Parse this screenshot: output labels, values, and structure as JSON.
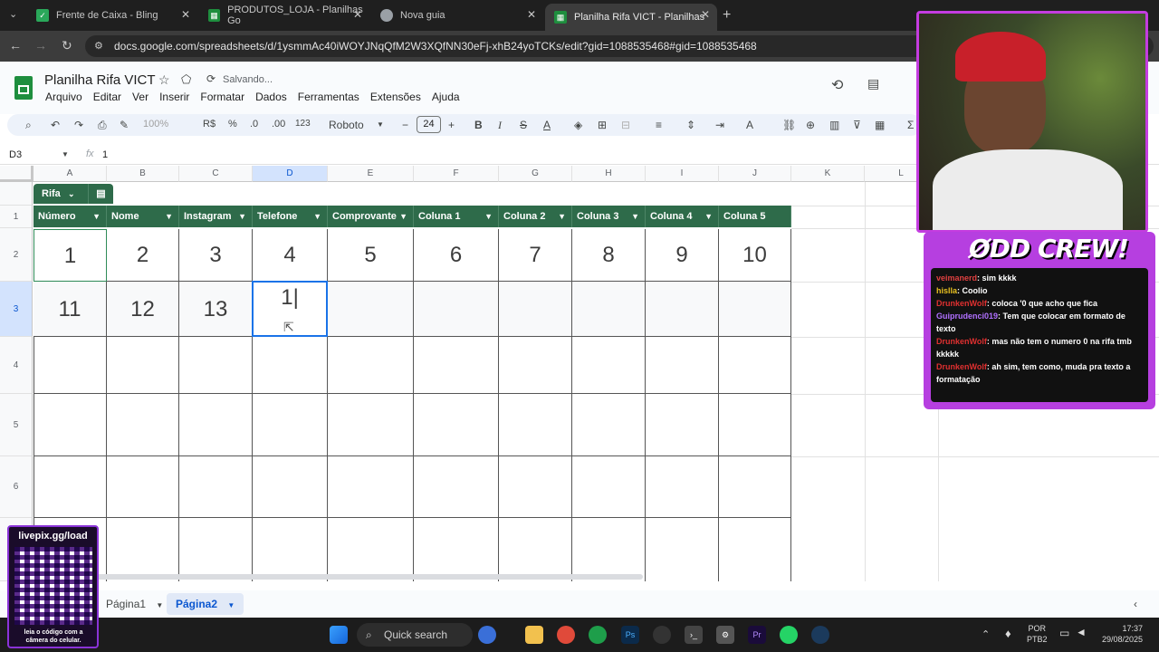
{
  "browser": {
    "tabs": [
      {
        "title": "Frente de Caixa - Bling",
        "icon": "bling-icon",
        "color": "#2aa85a"
      },
      {
        "title": "PRODUTOS_LOJA - Planilhas Go",
        "icon": "sheets-icon",
        "color": "#1e8e3e"
      },
      {
        "title": "Nova guia",
        "icon": "chrome-icon",
        "color": "#9aa0a6"
      },
      {
        "title": "Planilha Rifa VICT - Planilhas Go",
        "icon": "sheets-icon",
        "color": "#1e8e3e"
      }
    ],
    "url": "docs.google.com/spreadsheets/d/1ysmmAc40iWOYJNqQfM2W3XQfNN30eFj-xhB24yoTCKs/edit?gid=1088535468#gid=1088535468"
  },
  "sheets": {
    "title": "Planilha Rifa VICT",
    "status": "Salvando...",
    "menu": [
      "Arquivo",
      "Editar",
      "Ver",
      "Inserir",
      "Formatar",
      "Dados",
      "Ferramentas",
      "Extensões",
      "Ajuda"
    ],
    "toolbar": {
      "zoom": "100%",
      "currency": "R$",
      "percent": "%",
      "dec_less": ".0",
      "dec_more": ".00",
      "number_format": "123",
      "font": "Roboto",
      "font_size": "24"
    },
    "name_box": "D3",
    "formula": "1",
    "columns": [
      "A",
      "B",
      "C",
      "D",
      "E",
      "F",
      "G",
      "H",
      "I",
      "J",
      "K",
      "L"
    ],
    "rows": [
      "1",
      "2",
      "3",
      "4",
      "5",
      "6"
    ],
    "table_name": "Rifa",
    "table_headers": [
      "Número",
      "Nome",
      "Instagram",
      "Telefone",
      "Comprovante",
      "Coluna 1",
      "Coluna 2",
      "Coluna 3",
      "Coluna 4",
      "Coluna 5"
    ],
    "row2": [
      "1",
      "2",
      "3",
      "4",
      "5",
      "6",
      "7",
      "8",
      "9",
      "10"
    ],
    "row3": [
      "11",
      "12",
      "13",
      "1",
      "",
      "",
      "",
      "",
      "",
      ""
    ],
    "sheet_tabs": [
      "Página1",
      "Página2"
    ],
    "active_sheet": "Página2",
    "colors": {
      "header_green": "#2e6b4a",
      "selection_blue": "#1a73e8"
    }
  },
  "stream": {
    "brand": "ØDD CREW!",
    "chat": [
      {
        "user": "veimanerd",
        "msg": ": sim kkkk",
        "color": "#e04040"
      },
      {
        "user": "hislla",
        "msg": ": Coolio",
        "color": "#e8c020"
      },
      {
        "user": "DrunkenWolf",
        "msg": ": coloca '0 que acho que fica",
        "color": "#e03030"
      },
      {
        "user": "Guiprudenci019",
        "msg": ": Tem que colocar em formato de texto",
        "color": "#b070ff"
      },
      {
        "user": "DrunkenWolf",
        "msg": ": mas não tem o numero 0 na rifa tmb kkkkk",
        "color": "#e03030"
      },
      {
        "user": "DrunkenWolf",
        "msg": ": ah sim, tem como, muda pra texto a formatação",
        "color": "#e03030"
      }
    ],
    "livepix_url": "livepix.gg/load",
    "livepix_caption": "leia o código com a câmera do celular."
  },
  "taskbar": {
    "search_placeholder": "Quick search",
    "lang": "POR",
    "lang2": "PTB2",
    "time": "17:37",
    "date": "29/08/2025"
  }
}
